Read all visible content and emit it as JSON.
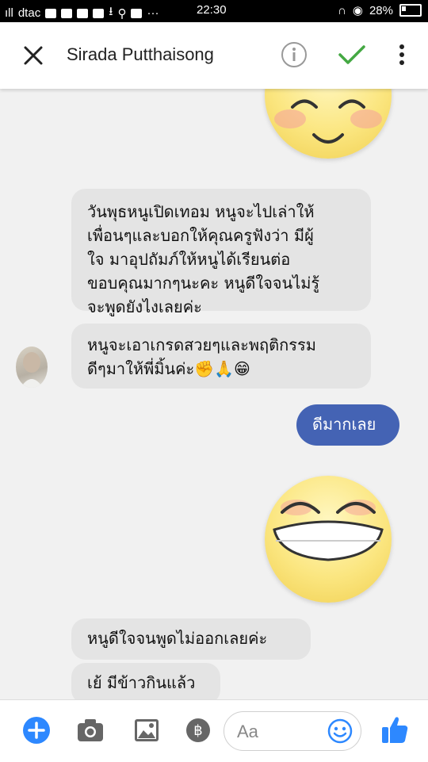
{
  "status_bar": {
    "carrier": "dtac",
    "time": "22:30",
    "battery": "28%"
  },
  "header": {
    "contact_name": "Sirada Putthaisong",
    "icons": [
      "close-icon",
      "info-icon",
      "check-icon",
      "more-vertical-icon"
    ]
  },
  "messages": [
    {
      "type": "sticker",
      "sender": "me",
      "icon": "smiling-face-sticker"
    },
    {
      "type": "text",
      "sender": "contact",
      "lines": [
        "วันพุธหนูเปิดเทอม หนูจะไปเล่าให้",
        "เพื่อนๆและบอกให้คุณครูฟังว่า มีผู้",
        "ใจ มาอุปถัมภ์ให้หนูได้เรียนต่อ",
        "ขอบคุณมากๆนะคะ หนูดีใจจนไม่รู้",
        "จะพูดยังไงเลยค่ะ"
      ]
    },
    {
      "type": "text",
      "sender": "contact",
      "lines": [
        "หนูจะเอาเกรดสวยๆและพฤติกรรม",
        "ดีๆมาให้พี่มิ้นค่ะ✊🙏😁"
      ]
    },
    {
      "type": "text",
      "sender": "me",
      "text": "ดีมากเลย"
    },
    {
      "type": "sticker",
      "sender": "me",
      "icon": "grinning-face-sticker"
    },
    {
      "type": "text",
      "sender": "contact",
      "text": "หนูดีใจจนพูดไม่ออกเลยค่ะ"
    },
    {
      "type": "text",
      "sender": "contact",
      "text": "เย้ มีข้าวกินแล้ว"
    }
  ],
  "composer": {
    "placeholder": "Aa",
    "icons": [
      "plus-icon",
      "camera-icon",
      "image-icon",
      "baht-icon",
      "emoji-icon",
      "thumbs-up-icon"
    ]
  },
  "colors": {
    "accent_blue": "#4463b4",
    "messenger_blue": "#2d88ff",
    "incoming_bubble": "#e4e4e4",
    "check_green": "#44a843"
  }
}
